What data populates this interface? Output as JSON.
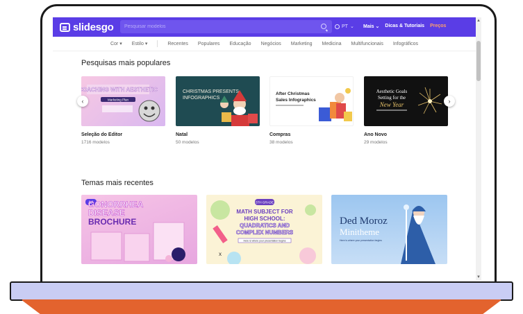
{
  "brand": {
    "logo_text": "slidesgo",
    "accent": "#5a3de6"
  },
  "search": {
    "placeholder": "Pesquisar modelos"
  },
  "header": {
    "language": "PT",
    "nav": [
      {
        "label": "Mais"
      },
      {
        "label": "Dicas & Tutoriais"
      },
      {
        "label": "Preços"
      }
    ]
  },
  "categories": [
    "Cor",
    "Estilo",
    "Recentes",
    "Populares",
    "Educação",
    "Negócios",
    "Marketing",
    "Medicina",
    "Multifuncionais",
    "Infográficos"
  ],
  "popular": {
    "title": "Pesquisas mais populares",
    "items": [
      {
        "title": "Seleção do Editor",
        "count": "1716 modelos",
        "thumb_text": "COACHING WITH AESTHETIC",
        "thumb_sub": "Marketing Plan"
      },
      {
        "title": "Natal",
        "count": "50 modelos",
        "thumb_text": "CHRISTMAS PRESENTS INFOGRAPHICS"
      },
      {
        "title": "Compras",
        "count": "38 modelos",
        "thumb_text": "After Christmas Sales Infographics"
      },
      {
        "title": "Ano Novo",
        "count": "29 modelos",
        "thumb_text": "Aesthetic Goals Setting for the",
        "thumb_sub": "New Year"
      }
    ]
  },
  "recent": {
    "title": "Temas mais recentes",
    "items": [
      {
        "badge": "AA",
        "title_lines": [
          "GONORRHEA",
          "DISEASE",
          "BROCHURE"
        ]
      },
      {
        "badge": "5TH GRADE",
        "title_lines": [
          "MATH SUBJECT FOR",
          "HIGH SCHOOL:",
          "QUADRATICS AND",
          "COMPLEX NUMBERS"
        ],
        "sub": "Here is where your presentation begins"
      },
      {
        "title_lines": [
          "Ded Moroz",
          "Minitheme"
        ],
        "sub": "Here is where your presentation begins"
      }
    ]
  }
}
